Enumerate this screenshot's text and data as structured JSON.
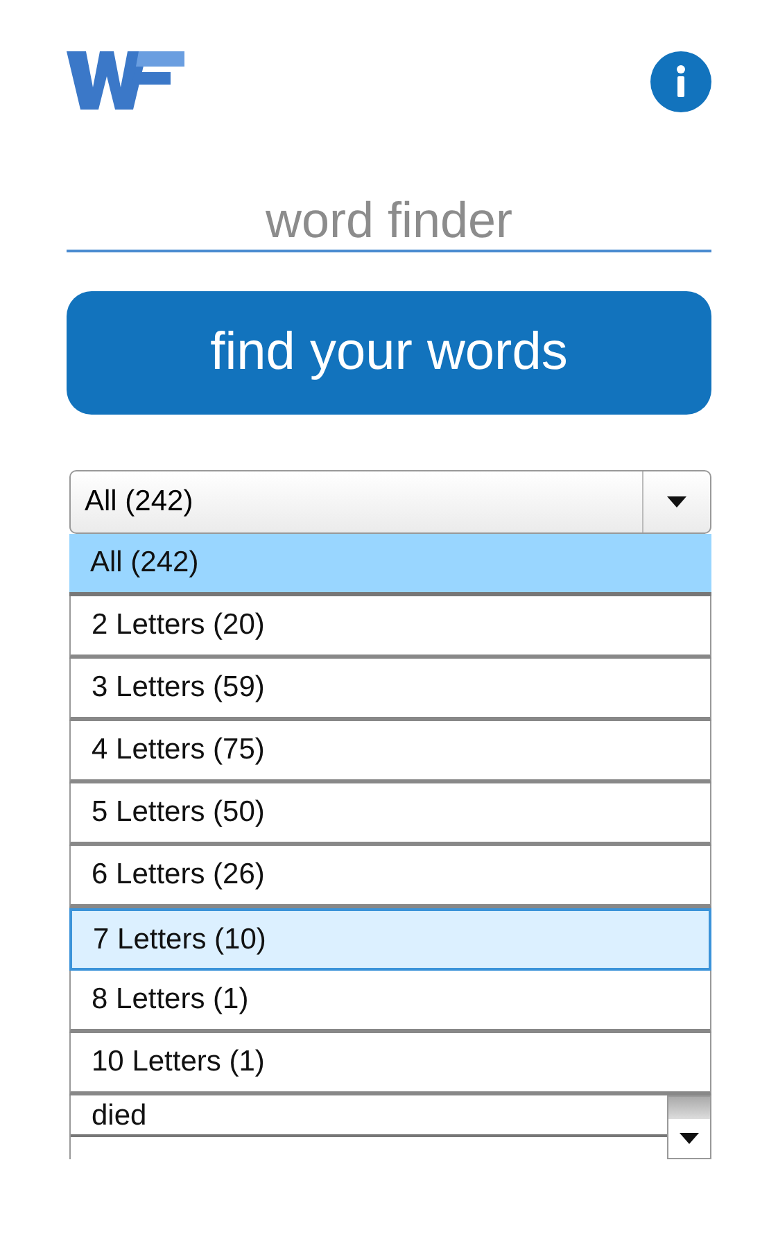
{
  "search": {
    "placeholder": "word finder"
  },
  "find_button": {
    "label": "find your words"
  },
  "filter": {
    "value": "All (242)",
    "options": [
      {
        "label": "All (242)",
        "selected": true,
        "focused": false
      },
      {
        "label": "2 Letters (20)",
        "selected": false,
        "focused": false
      },
      {
        "label": "3 Letters (59)",
        "selected": false,
        "focused": false
      },
      {
        "label": "4 Letters (75)",
        "selected": false,
        "focused": false
      },
      {
        "label": "5 Letters (50)",
        "selected": false,
        "focused": false
      },
      {
        "label": "6 Letters (26)",
        "selected": false,
        "focused": false
      },
      {
        "label": "7 Letters (10)",
        "selected": false,
        "focused": true
      },
      {
        "label": "8 Letters (1)",
        "selected": false,
        "focused": false
      },
      {
        "label": "10 Letters (1)",
        "selected": false,
        "focused": false
      }
    ]
  },
  "results": [
    "died"
  ]
}
